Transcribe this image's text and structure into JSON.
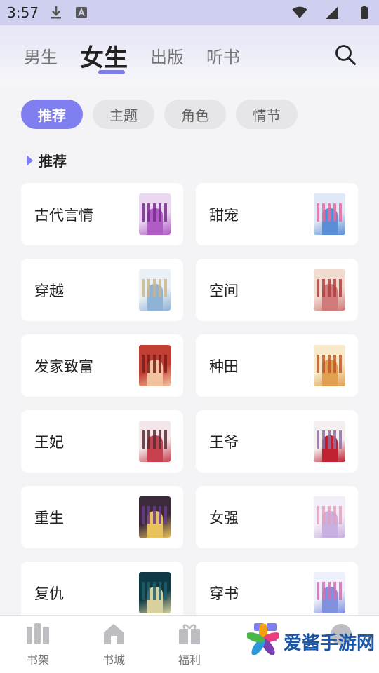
{
  "status_bar": {
    "time": "3:57"
  },
  "header": {
    "tabs": [
      {
        "label": "男生",
        "active": false
      },
      {
        "label": "女生",
        "active": true
      },
      {
        "label": "出版",
        "active": false
      },
      {
        "label": "听书",
        "active": false
      }
    ]
  },
  "chips": [
    {
      "label": "推荐",
      "active": true
    },
    {
      "label": "主题",
      "active": false
    },
    {
      "label": "角色",
      "active": false
    },
    {
      "label": "情节",
      "active": false
    }
  ],
  "section": {
    "title": "推荐"
  },
  "categories": [
    {
      "label": "古代言情",
      "cover_colors": [
        "#e9d8f0",
        "#b05cc5",
        "#7a2a8e"
      ]
    },
    {
      "label": "甜宠",
      "cover_colors": [
        "#dfe8f7",
        "#5a8fd8",
        "#e86aa0"
      ]
    },
    {
      "label": "穿越",
      "cover_colors": [
        "#eaf0f5",
        "#8fb3d6",
        "#c9b78a"
      ]
    },
    {
      "label": "空间",
      "cover_colors": [
        "#f1dcd2",
        "#d27a7a",
        "#b04040"
      ]
    },
    {
      "label": "发家致富",
      "cover_colors": [
        "#c23d34",
        "#f2c3a0",
        "#7a1c18"
      ]
    },
    {
      "label": "种田",
      "cover_colors": [
        "#f7e9c9",
        "#e0a050",
        "#c05a2a"
      ]
    },
    {
      "label": "王妃",
      "cover_colors": [
        "#f3e6e8",
        "#c9404f",
        "#5a2a35"
      ]
    },
    {
      "label": "王爷",
      "cover_colors": [
        "#f5f0f0",
        "#c02030",
        "#9070a0"
      ]
    },
    {
      "label": "重生",
      "cover_colors": [
        "#3b2a3a",
        "#e8c25a",
        "#6a3a8a"
      ]
    },
    {
      "label": "女强",
      "cover_colors": [
        "#f3eef7",
        "#c8b0e0",
        "#e3a0c0"
      ]
    },
    {
      "label": "复仇",
      "cover_colors": [
        "#0f3a45",
        "#d9d0a0",
        "#20606a"
      ]
    },
    {
      "label": "穿书",
      "cover_colors": [
        "#eef0fb",
        "#8090e0",
        "#d070b0"
      ]
    }
  ],
  "bottom_nav": [
    {
      "label": "书架",
      "icon": "bookshelf-icon"
    },
    {
      "label": "书城",
      "icon": "bookstore-icon"
    },
    {
      "label": "福利",
      "icon": "gift-icon"
    },
    {
      "label": "",
      "icon": "category-icon"
    },
    {
      "label": "",
      "icon": "profile-icon"
    }
  ],
  "watermark": {
    "text": "爱酱手游网"
  },
  "colors": {
    "accent": "#7f7ff0",
    "status_bar": "#cfcff0"
  }
}
